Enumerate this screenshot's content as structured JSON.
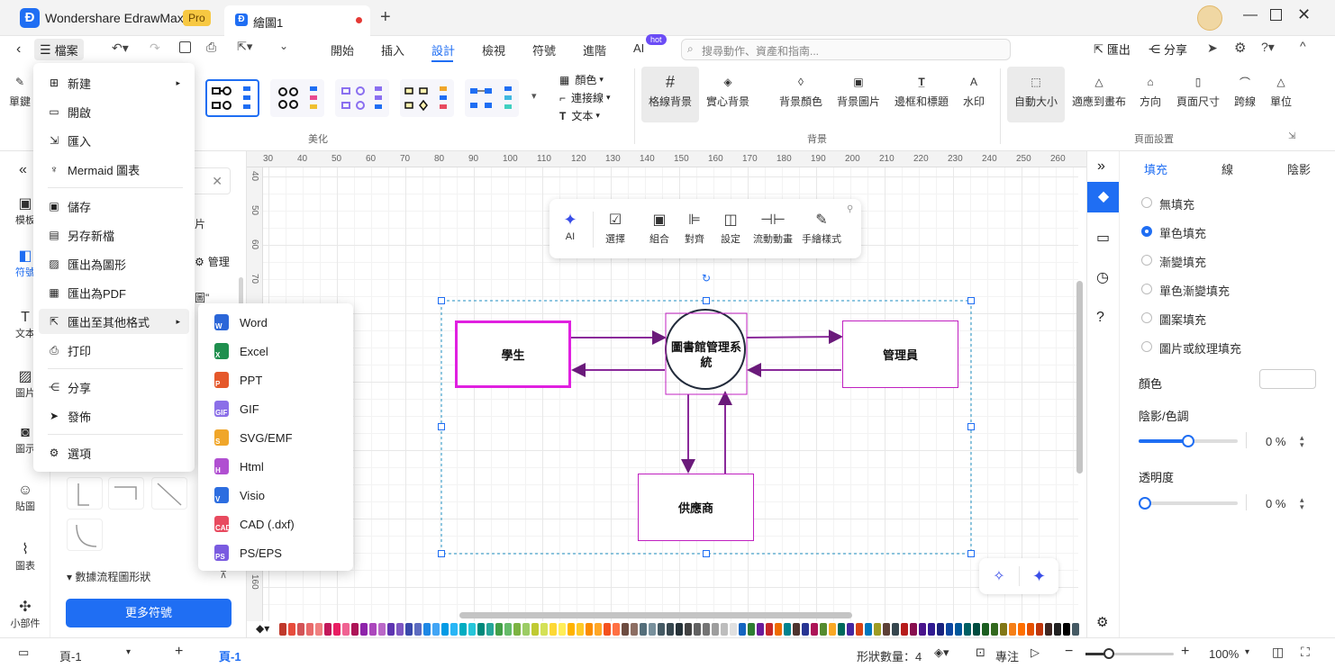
{
  "app": {
    "title": "Wondershare EdrawMax",
    "badge": "Pro"
  },
  "tab": {
    "label": "繪圖1"
  },
  "menubar": {
    "file": "檔案",
    "items": [
      "開始",
      "插入",
      "設計",
      "檢視",
      "符號",
      "進階",
      "AI"
    ],
    "active": "設計",
    "hot": "hot",
    "search_placeholder": "搜尋動作、資產和指南...",
    "export": "匯出",
    "share": "分享"
  },
  "ribbon": {
    "partial_left": "單鍵",
    "color": "顏色",
    "connector": "連接線",
    "text": "文本",
    "beautify": "美化",
    "grid_bg": "格線背景",
    "solid_bg": "實心背景",
    "bg_color": "背景顏色",
    "bg_image": "背景圖片",
    "border_title": "邊框和標題",
    "watermark": "水印",
    "background": "背景",
    "auto_size": "自動大小",
    "fit_canvas": "適應到畫布",
    "orientation": "方向",
    "page_size": "頁面尺寸",
    "jump": "跨線",
    "unit": "單位",
    "page_setup": "頁面設置"
  },
  "leftbar": {
    "items": [
      "模板",
      "符號",
      "文本",
      "圖片",
      "圖示",
      "貼圖",
      "圖表",
      "小部件"
    ]
  },
  "shapepanel": {
    "manage": "管理",
    "partial_text": "范圖\"",
    "partial_tab": "片",
    "category": "數據流程圖形狀",
    "more": "更多符號"
  },
  "ruler": {
    "top": [
      "30",
      "40",
      "50",
      "60",
      "70",
      "80",
      "90",
      "100",
      "110",
      "120",
      "130",
      "140",
      "150",
      "160",
      "170",
      "180",
      "190",
      "200",
      "210",
      "220",
      "230",
      "240",
      "250",
      "260"
    ],
    "left": [
      "40",
      "50",
      "60",
      "70",
      "160"
    ]
  },
  "floattoolbar": {
    "items": [
      "AI",
      "選擇",
      "組合",
      "對齊",
      "設定",
      "流動動畫",
      "手繪樣式"
    ]
  },
  "diagram": {
    "student": "學生",
    "system": "圖書館管理系統",
    "admin": "管理員",
    "supplier": "供應商"
  },
  "filemenu": {
    "items": [
      "新建",
      "開啟",
      "匯入",
      "Mermaid 圖表",
      "儲存",
      "另存新檔",
      "匯出為圖形",
      "匯出為PDF",
      "匯出至其他格式",
      "打印",
      "分享",
      "發佈",
      "選項"
    ]
  },
  "submenu": {
    "items": [
      {
        "label": "Word",
        "tag": "W",
        "color": "#2b66d8"
      },
      {
        "label": "Excel",
        "tag": "X",
        "color": "#1f8f4e"
      },
      {
        "label": "PPT",
        "tag": "P",
        "color": "#e5582b"
      },
      {
        "label": "GIF",
        "tag": "GIF",
        "color": "#8b6fe8"
      },
      {
        "label": "SVG/EMF",
        "tag": "S",
        "color": "#f0a62a"
      },
      {
        "label": "Html",
        "tag": "H",
        "color": "#b04fd1"
      },
      {
        "label": "Visio",
        "tag": "V",
        "color": "#2c6de0"
      },
      {
        "label": "CAD (.dxf)",
        "tag": "CAD",
        "color": "#e84a5f"
      },
      {
        "label": "PS/EPS",
        "tag": "PS",
        "color": "#7a5be0"
      }
    ]
  },
  "rightpanel": {
    "tabs": [
      "填充",
      "線",
      "陰影"
    ],
    "fill_options": [
      "無填充",
      "單色填充",
      "漸變填充",
      "單色漸變填充",
      "圖案填充",
      "圖片或紋理填充"
    ],
    "selected": "單色填充",
    "color_label": "顏色",
    "shade_label": "陰影/色調",
    "shade_value": "0 %",
    "transparency_label": "透明度",
    "transparency_value": "0 %",
    "shade_level": 0.5,
    "transparency_level": 0
  },
  "statusbar": {
    "page_tab": "頁-1",
    "page_current": "頁-1",
    "shape_count": "形狀數量：4",
    "focus": "專注",
    "zoom": "100%"
  },
  "colors": {
    "accent": "#1f6ef3",
    "magenta": "#e020e0",
    "purple": "#8a2a9a"
  }
}
